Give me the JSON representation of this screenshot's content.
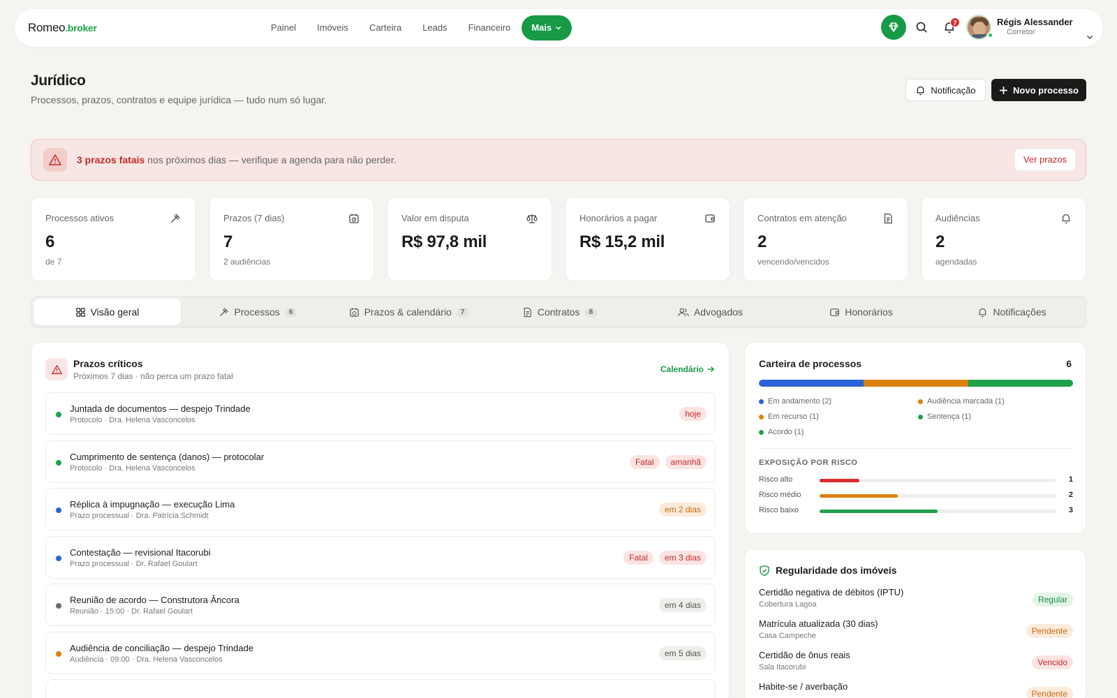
{
  "brand": {
    "name": "Romeo",
    "suffix": ".broker"
  },
  "nav": {
    "items": [
      "Painel",
      "Imóveis",
      "Carteira",
      "Leads",
      "Financeiro"
    ],
    "more_label": "Mais",
    "notifications_count": "7",
    "user_name": "Régis Alessander",
    "user_role": "Corretor"
  },
  "page": {
    "title": "Jurídico",
    "subtitle": "Processos, prazos, contratos e equipe jurídica — tudo num só lugar.",
    "notify_label": "Notificação",
    "new_label": "Novo processo"
  },
  "alert": {
    "strong": "3 prazos fatais",
    "text": " nos próximos dias — verifique a agenda para não perder.",
    "button": "Ver prazos"
  },
  "kpis": [
    {
      "label": "Processos ativos",
      "value": "6",
      "sub": "de 7",
      "icon": "gavel-icon"
    },
    {
      "label": "Prazos (7 dias)",
      "value": "7",
      "sub": "2 audiências",
      "icon": "calendar-clock-icon"
    },
    {
      "label": "Valor em disputa",
      "value": "R$ 97,8 mil",
      "sub": "",
      "icon": "scale-icon"
    },
    {
      "label": "Honorários a pagar",
      "value": "R$ 15,2 mil",
      "sub": "",
      "icon": "wallet-icon"
    },
    {
      "label": "Contratos em atenção",
      "value": "2",
      "sub": "vencendo/vencidos",
      "icon": "document-icon"
    },
    {
      "label": "Audiências",
      "value": "2",
      "sub": "agendadas",
      "icon": "bell-icon"
    }
  ],
  "tabs": [
    {
      "label": "Visão geral",
      "count": "",
      "icon": "grid-icon"
    },
    {
      "label": "Processos",
      "count": "6",
      "icon": "gavel-icon"
    },
    {
      "label": "Prazos & calendário",
      "count": "7",
      "icon": "calendar-clock-icon"
    },
    {
      "label": "Contratos",
      "count": "8",
      "icon": "document-icon"
    },
    {
      "label": "Advogados",
      "count": "",
      "icon": "users-icon"
    },
    {
      "label": "Honorários",
      "count": "",
      "icon": "wallet-icon"
    },
    {
      "label": "Notificações",
      "count": "",
      "icon": "bell-icon"
    }
  ],
  "prazos": {
    "title": "Prazos críticos",
    "subtitle": "Próximos 7 dias · não perca um prazo fatal",
    "link": "Calendário",
    "items": [
      {
        "title": "Juntada de documentos — despejo Trindade",
        "sub": "Protocolo · Dra. Helena Vasconcelos",
        "dot": "#1fa14a",
        "tags": [
          {
            "text": "hoje",
            "kind": "t-red"
          }
        ]
      },
      {
        "title": "Cumprimento de sentença (danos) — protocolar",
        "sub": "Protocolo · Dra. Helena Vasconcelos",
        "dot": "#1fa14a",
        "tags": [
          {
            "text": "Fatal",
            "kind": "t-red"
          },
          {
            "text": "amanhã",
            "kind": "t-red"
          }
        ]
      },
      {
        "title": "Réplica à impugnação — execução Lima",
        "sub": "Prazo processual · Dra. Patrícia Schmidt",
        "dot": "#2a63d9",
        "tags": [
          {
            "text": "em 2 dias",
            "kind": "t-orange"
          }
        ]
      },
      {
        "title": "Contestação — revisional Itacorubi",
        "sub": "Prazo processual · Dr. Rafael Goulart",
        "dot": "#2a63d9",
        "tags": [
          {
            "text": "Fatal",
            "kind": "t-red"
          },
          {
            "text": "em 3 dias",
            "kind": "t-red"
          }
        ]
      },
      {
        "title": "Reunião de acordo — Construtora Âncora",
        "sub": "Reunião · 15:00 · Dr. Rafael Goulart",
        "dot": "#6b6b6b",
        "tags": [
          {
            "text": "em 4 dias",
            "kind": "t-gray"
          }
        ]
      },
      {
        "title": "Audiência de conciliação — despejo Trindade",
        "sub": "Audiência · 09:00 · Dra. Helena Vasconcelos",
        "dot": "#d9820f",
        "tags": [
          {
            "text": "em 5 dias",
            "kind": "t-gray"
          }
        ]
      }
    ]
  },
  "carteira": {
    "title": "Carteira de processos",
    "total": "6",
    "segments": [
      {
        "label": "Em andamento (2)",
        "count": 2,
        "color": "#2a63d9"
      },
      {
        "label": "Audiência marcada (1)",
        "count": 1,
        "color": "#d9820f"
      },
      {
        "label": "Em recurso (1)",
        "count": 1,
        "color": "#d9820f"
      },
      {
        "label": "Sentença (1)",
        "count": 1,
        "color": "#1fa14a"
      },
      {
        "label": "Acordo (1)",
        "count": 1,
        "color": "#1fa14a"
      }
    ],
    "risk_title": "EXPOSIÇÃO POR RISCO",
    "risks": [
      {
        "label": "Risco alto",
        "value": "1",
        "fraction": 0.17,
        "color": "#d92d2d"
      },
      {
        "label": "Risco médio",
        "value": "2",
        "fraction": 0.33,
        "color": "#d9820f"
      },
      {
        "label": "Risco baixo",
        "value": "3",
        "fraction": 0.5,
        "color": "#1fa14a"
      }
    ]
  },
  "regularidade": {
    "title": "Regularidade dos imóveis",
    "items": [
      {
        "title": "Certidão negativa de débitos (IPTU)",
        "sub": "Cobertura Lagoa",
        "status": "Regular",
        "kind": "t-green"
      },
      {
        "title": "Matrícula atualizada (30 dias)",
        "sub": "Casa Campeche",
        "status": "Pendente",
        "kind": "t-orange"
      },
      {
        "title": "Certidão de ônus reais",
        "sub": "Sala Itacorubi",
        "status": "Vencido",
        "kind": "t-red"
      },
      {
        "title": "Habite-se / averbação",
        "sub": "",
        "status": "Pendente",
        "kind": "t-orange"
      }
    ]
  }
}
